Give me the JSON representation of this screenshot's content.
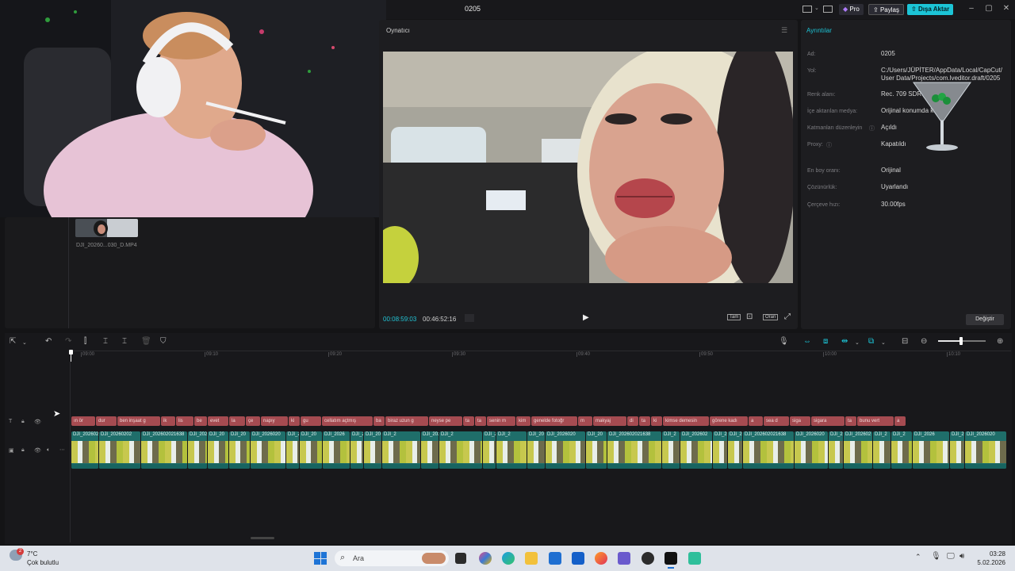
{
  "window": {
    "title": "0205",
    "pro_label": "Pro",
    "share_label": "Paylaş",
    "export_label": "Dışa Aktar"
  },
  "media": {
    "clip_name": "DJI_20260...030_D.MP4"
  },
  "player": {
    "title": "Oynatıcı",
    "current_time": "00:08:59:03",
    "total_time": "00:46:52:16",
    "tam_label": "Tam",
    "oran_label": "Oran"
  },
  "details": {
    "title": "Ayrıntılar",
    "rows": [
      {
        "label": "Ad:",
        "value": "0205"
      },
      {
        "label": "Yol:",
        "value": "C:/Users/JÜPİTER/AppData/Local/CapCut/User Data/Projects/com.lveditor.draft/0205"
      },
      {
        "label": "Renk alanı:",
        "value": "Rec. 709 SDR"
      },
      {
        "label": "İçe aktarılan medya:",
        "value": "Orijinal konumda k"
      },
      {
        "label": "Katmanları düzenleyin",
        "value": "Açıldı"
      },
      {
        "label": "Proxy:",
        "value": "Kapatıldı"
      },
      {
        "label": "En boy oranı:",
        "value": "Orijinal"
      },
      {
        "label": "Çözünürlük:",
        "value": "Uyarlandı"
      },
      {
        "label": "Çerçeve hızı:",
        "value": "30.00fps"
      }
    ],
    "change_label": "Değiştir"
  },
  "timeline": {
    "ruler": [
      "09:00",
      "09:10",
      "09:20",
      "09:30",
      "09:40",
      "09:50",
      "10:00",
      "10:10"
    ],
    "text_clips": [
      "ın ör",
      "dur",
      "ben inşaat g",
      "ik",
      "lis",
      "be",
      "evet",
      "la",
      "çe",
      "napıy",
      "ki",
      "gu",
      "cellatım açtmış",
      "ba",
      "biraz uzun g",
      "neyse pe",
      "ta",
      "ta",
      "senin m",
      "kim",
      "genelde fotoğr",
      "m",
      "makyaj",
      "di",
      "ta",
      "ki",
      "kimse demesin",
      "görene kadı",
      "a",
      "sea d",
      "siga",
      "sigara",
      "ta",
      "bunu vert",
      "a"
    ],
    "video_clips": [
      "DJI_20260202163",
      "DJI_20260202",
      "DJI_202602021638",
      "DJI_202",
      "DJI_20",
      "DJI_20",
      "DJI_2026020",
      "DJI_2",
      "DJI_20",
      "DJI_2026",
      "DJI_2",
      "DJI_20",
      "DJI_2",
      "DJI_20260202",
      "DJI_2",
      "DJI_2026020",
      "DJI_2",
      "DJI_20",
      "DJI_2026020",
      "DJI_20",
      "DJI_202602021638",
      "DJI_2",
      "DJI_202602",
      "DJI_2",
      "DJI_2",
      "DJI_202602021638",
      "DJI_2026020",
      "DJI_2",
      "DJI_202602",
      "DJI_2",
      "DJI_2",
      "DJI_2026",
      "DJI_2",
      "DJI_2026020",
      "DJI_2"
    ]
  },
  "taskbar": {
    "weather_temp": "7°C",
    "weather_desc": "Çok bulutlu",
    "weather_badge": "2",
    "search_placeholder": "Ara",
    "time": "03:28",
    "date": "5.02.2026"
  }
}
